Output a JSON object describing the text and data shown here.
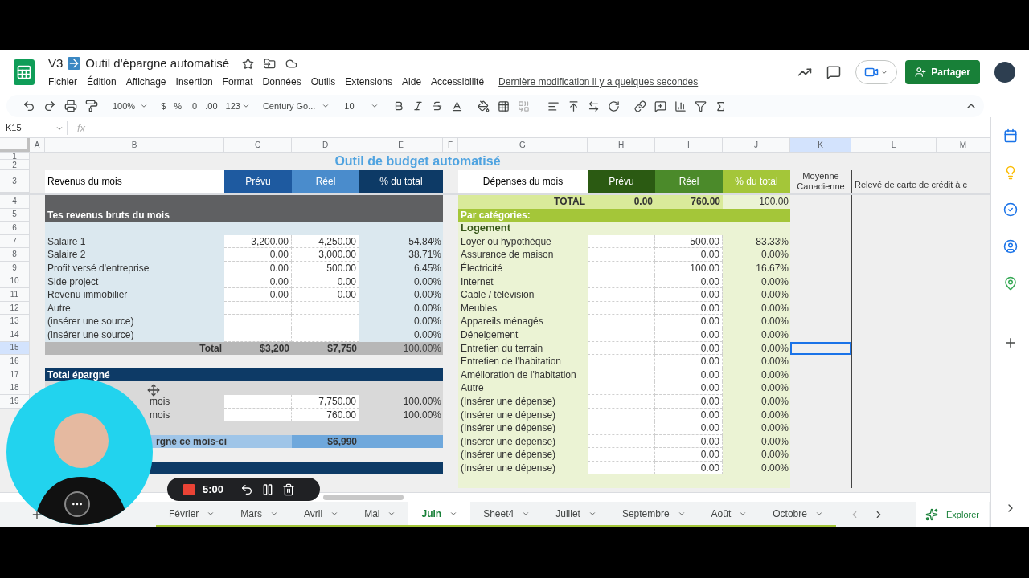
{
  "document": {
    "prefix": "V3",
    "title": "Outil d'épargne automatisé",
    "last_modified": "Dernière modification il y a quelques secondes"
  },
  "menu": [
    "Fichier",
    "Édition",
    "Affichage",
    "Insertion",
    "Format",
    "Données",
    "Outils",
    "Extensions",
    "Aide",
    "Accessibilité"
  ],
  "share_button": "Partager",
  "toolbar": {
    "zoom": "100%",
    "currency": "$",
    "percent": "%",
    "decimal_less": ".0",
    "decimal_more": ".00",
    "number_format": "123",
    "font": "Century Go...",
    "font_size": "10"
  },
  "formula_bar": {
    "cell_ref": "K15",
    "fx": "fx"
  },
  "columns": [
    "A",
    "B",
    "C",
    "D",
    "E",
    "F",
    "G",
    "H",
    "I",
    "J",
    "K",
    "L",
    "M"
  ],
  "row_numbers": [
    "1",
    "2",
    "3",
    "4",
    "5",
    "6",
    "7",
    "8",
    "9",
    "10",
    "11",
    "12",
    "13",
    "14",
    "15",
    "16",
    "17",
    "18",
    "19"
  ],
  "sheet_title": "Outil de budget automatisé",
  "income": {
    "header": "Revenus du mois",
    "col_headers": [
      "Prévu",
      "Réel",
      "% du total"
    ],
    "section": "Tes revenus bruts du mois",
    "rows": [
      {
        "label": "Salaire 1",
        "planned": "3,200.00",
        "actual": "4,250.00",
        "pct": "54.84%"
      },
      {
        "label": "Salaire 2",
        "planned": "0.00",
        "actual": "3,000.00",
        "pct": "38.71%"
      },
      {
        "label": "Profit versé d'entreprise",
        "planned": "0.00",
        "actual": "500.00",
        "pct": "6.45%"
      },
      {
        "label": "Side project",
        "planned": "0.00",
        "actual": "0.00",
        "pct": "0.00%"
      },
      {
        "label": "Revenu immobilier",
        "planned": "0.00",
        "actual": "0.00",
        "pct": "0.00%"
      },
      {
        "label": "Autre",
        "pct": "0.00%"
      },
      {
        "label": "(insérer une source)",
        "pct": "0.00%"
      },
      {
        "label": "(insérer une source)",
        "pct": "0.00%"
      }
    ],
    "total": {
      "label": "Total",
      "planned": "$3,200",
      "actual": "$7,750",
      "pct": "100.00%"
    }
  },
  "savings": {
    "section": "Total épargné",
    "rows": [
      {
        "label": "mois",
        "actual": "7,750.00",
        "pct": "100.00%"
      },
      {
        "label": "mois",
        "actual": "760.00",
        "pct": "100.00%"
      }
    ],
    "total": {
      "label": "rgné ce mois-ci",
      "value": "$6,990"
    }
  },
  "expenses": {
    "header": "Dépenses du mois",
    "col_headers": [
      "Prévu",
      "Réel",
      "% du total"
    ],
    "total": {
      "label": "TOTAL",
      "planned": "0.00",
      "actual": "760.00",
      "pct": "100.00"
    },
    "section": "Par catégories:",
    "category": "Logement",
    "rows": [
      {
        "label": "Loyer ou hypothèque",
        "actual": "500.00",
        "pct": "83.33%"
      },
      {
        "label": "Assurance de maison",
        "actual": "0.00",
        "pct": "0.00%"
      },
      {
        "label": "Électricité",
        "actual": "100.00",
        "pct": "16.67%"
      },
      {
        "label": "Internet",
        "actual": "0.00",
        "pct": "0.00%"
      },
      {
        "label": "Cable / télévision",
        "actual": "0.00",
        "pct": "0.00%"
      },
      {
        "label": "Meubles",
        "actual": "0.00",
        "pct": "0.00%"
      },
      {
        "label": "Appareils ménagés",
        "actual": "0.00",
        "pct": "0.00%"
      },
      {
        "label": "Déneigement",
        "actual": "0.00",
        "pct": "0.00%"
      },
      {
        "label": "Entretien du terrain",
        "actual": "0.00",
        "pct": "0.00%"
      },
      {
        "label": "Entretien de l'habitation",
        "actual": "0.00",
        "pct": "0.00%"
      },
      {
        "label": "Amélioration de l'habitation",
        "actual": "0.00",
        "pct": "0.00%"
      },
      {
        "label": "Autre",
        "actual": "0.00",
        "pct": "0.00%"
      },
      {
        "label": "(Insérer une dépense)",
        "actual": "0.00",
        "pct": "0.00%"
      },
      {
        "label": "(Insérer une dépense)",
        "actual": "0.00",
        "pct": "0.00%"
      },
      {
        "label": "(Insérer une dépense)",
        "actual": "0.00",
        "pct": "0.00%"
      },
      {
        "label": "(Insérer une dépense)",
        "actual": "0.00",
        "pct": "0.00%"
      },
      {
        "label": "(Insérer une dépense)",
        "actual": "0.00",
        "pct": "0.00%"
      },
      {
        "label": "(Insérer une dépense)",
        "actual": "0.00",
        "pct": "0.00%"
      }
    ]
  },
  "extra_headers": [
    "Moyenne Canadienne",
    "Relevé de carte de crédit à c"
  ],
  "tabs": [
    {
      "label": "Février",
      "selected": false
    },
    {
      "label": "Mars",
      "selected": false
    },
    {
      "label": "Avril",
      "selected": false
    },
    {
      "label": "Mai",
      "selected": false
    },
    {
      "label": "Juin",
      "selected": true
    },
    {
      "label": "Sheet4",
      "selected": false
    },
    {
      "label": "Juillet",
      "selected": false
    },
    {
      "label": "Septembre",
      "selected": false
    },
    {
      "label": "Août",
      "selected": false
    },
    {
      "label": "Octobre",
      "selected": false
    }
  ],
  "explore_button": "Explorer",
  "recorder": {
    "time": "5:00"
  }
}
